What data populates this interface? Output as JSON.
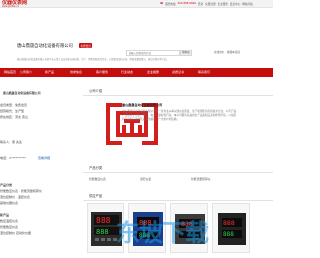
{
  "topbar": {
    "brand": "仪器仪表网",
    "brand_sub": "www.ybzhan.cn",
    "phone_label": "服务热线",
    "phone": "400-888-6666",
    "links": [
      "登录",
      "免费注册",
      "企业服务",
      "会员中心",
      "网站导航"
    ]
  },
  "header": {
    "company_title": "唐山鼎晟自动化设备有限公司",
    "badge": "免费会员",
    "search_placeholder": "请输入您要找的产品",
    "search_button": "搜本店",
    "login_tip": "在线询价 · 收藏本商铺"
  },
  "announce": "唐山鼎晟自动化设备有限公司是专业从事工业自动化仪表研发、生产、销售和服务的企业，主营数显温控仪表、智能流量积算仪、液位控制仪等产品。",
  "nav": {
    "items": [
      "网站首页",
      "公司简介",
      "新产品",
      "供求信息",
      "客户服务",
      "行业动态",
      "企业相册",
      "资质证书",
      "联系我们"
    ]
  },
  "left": {
    "company_name": "唐山鼎晟自动化设备有限公司",
    "lines": [
      "会员类型：免费会员",
      "经营模式：生产型",
      "所在地区：河北 唐山",
      "联系人：吴 先生",
      "电话：1**********",
      "查看详细",
      "",
      "产品分类",
      "智能数显仪表 · 智能流量积算仪",
      "液位控制仪 · 温控仪表",
      "其他仪器仪表",
      "新产品",
      "数显温控仪表",
      "智能数显仪表",
      "液位控制仪 自动化仪器"
    ]
  },
  "main": {
    "intro_title": "公司介绍",
    "intro_name": "唐山鼎晟自动化设备有限公司",
    "intro_text": "唐山鼎晟自动化设备有限公司是一家专业从事仪器仪表研发、生产和销售的高新技术企业，公司产品广泛应用于冶金、化工、电力、建材等行业。本公司拥有先进的生产设备和完善的检测手段，以优质的产品和完善的售后服务赢得了广大用户的信赖。",
    "cat_title": "产品分类",
    "categories": [
      "智能数显仪表",
      "温控仪表",
      "智能流量积算仪"
    ],
    "products_title": "供应产品",
    "watermark": "东坡下载"
  },
  "colors": {
    "brand_red": "#c81010",
    "nav_red": "#c40d0d",
    "watermark_blue": "#1e96e6"
  }
}
